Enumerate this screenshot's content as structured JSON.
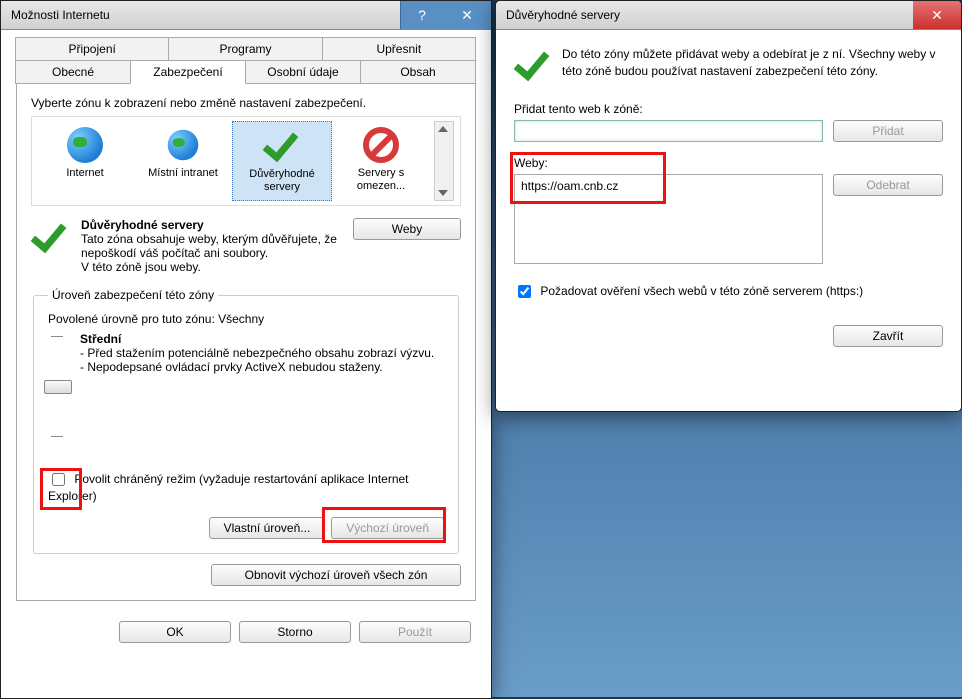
{
  "dlg1": {
    "title": "Možnosti Internetu",
    "tabs_row1": [
      "Připojení",
      "Programy",
      "Upřesnit"
    ],
    "tabs_row2": [
      "Obecné",
      "Zabezpečení",
      "Osobní údaje",
      "Obsah"
    ],
    "zone_prompt": "Vyberte zónu k zobrazení nebo změně nastavení zabezpečení.",
    "zones": {
      "internet": "Internet",
      "intranet": "Místní intranet",
      "trusted": "Důvěryhodné servery",
      "restricted": "Servery s omezen..."
    },
    "trusted_title": "Důvěryhodné servery",
    "trusted_desc1": "Tato zóna obsahuje weby, kterým důvěřujete, že nepoškodí váš počítač ani soubory.",
    "trusted_desc2": "V této zóně jsou weby.",
    "sites_btn": "Weby",
    "level_group": "Úroveň zabezpečení této zóny",
    "allowed_levels": "Povolené úrovně pro tuto zónu: Všechny",
    "level_name": "Střední",
    "level_line1": "- Před stažením potenciálně nebezpečného obsahu zobrazí výzvu.",
    "level_line2": "- Nepodepsané ovládací prvky ActiveX nebudou staženy.",
    "protected_mode": "Povolit chráněný režim (vyžaduje restartování aplikace Internet Explorer)",
    "custom_level_btn": "Vlastní úroveň...",
    "default_level_btn": "Výchozí úroveň",
    "reset_all_btn": "Obnovit výchozí úroveň všech zón",
    "ok": "OK",
    "cancel": "Storno",
    "apply": "Použít"
  },
  "dlg2": {
    "title": "Důvěryhodné servery",
    "intro": "Do této zóny můžete přidávat weby a odebírat je z ní. Všechny weby v této zóně budou používat nastavení zabezpečení této zóny.",
    "add_label": "Přidat tento web k zóně:",
    "add_btn": "Přidat",
    "sites_label": "Weby:",
    "site_entry": "https://oam.cnb.cz",
    "remove_btn": "Odebrat",
    "require_https": "Požadovat ověření všech webů v této zóně serverem (https:)",
    "close_btn": "Zavřít"
  }
}
